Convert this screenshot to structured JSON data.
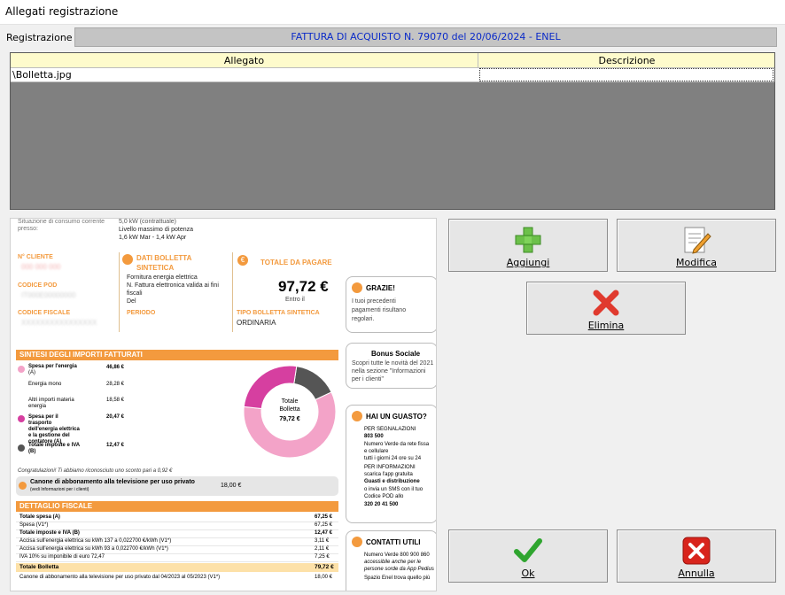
{
  "window": {
    "title": "Allegati registrazione"
  },
  "registration": {
    "label": "Registrazione",
    "value": "FATTURA DI ACQUISTO N. 79070 del 20/06/2024 - ENEL"
  },
  "grid": {
    "columns": [
      "Allegato",
      "Descrizione"
    ],
    "rows": [
      {
        "file": "\\Bolletta.jpg",
        "description": ""
      }
    ]
  },
  "buttons": {
    "add": "Aggiungi",
    "edit": "Modifica",
    "delete": "Elimina",
    "ok": "Ok",
    "cancel": "Annulla"
  },
  "icons": {
    "add": "plus-icon",
    "edit": "edit-document-icon",
    "delete": "red-x-icon",
    "ok": "green-check-icon",
    "cancel": "red-x-square-icon"
  },
  "preview": {
    "top_left_1": "Situazione di consumo corrente",
    "top_left_2": "presso:",
    "top_mid_1": "5,0 kW (contrattuale)",
    "top_mid_2": "Livello massimo di potenza",
    "top_mid_3": "1,6 kW Mar - 1,4 kW Apr",
    "cliente_label": "N° CLIENTE",
    "cliente_value": "000 000 000",
    "pod_label": "CODICE POD",
    "pod_value": "IT000E00000000",
    "cf_label": "CODICE FISCALE",
    "cf_value": "XXXXXXXXXXXXXXXX",
    "dati_title_1": "DATI BOLLETTA",
    "dati_title_2": "SINTETICA",
    "dati_line_1": "Fornitura energia elettrica",
    "dati_line_2": "N. Fattura elettronica valida ai fini",
    "dati_line_3": "fiscali",
    "dati_line_4": "Del",
    "periodo_label": "PERIODO",
    "totale_title": "TOTALE DA PAGARE",
    "totale_value": "97,72 €",
    "entro": "Entro il",
    "tipo_label": "TIPO BOLLETTA SINTETICA",
    "tipo_value": "ORDINARIA",
    "grazie_title": "GRAZIE!",
    "grazie_text_1": "I tuoi precedenti",
    "grazie_text_2": "pagamenti risultano",
    "grazie_text_3": "regolari.",
    "bonus_title": "Bonus Sociale",
    "bonus_text_1": "Scopri tutte le novità del 2021",
    "bonus_text_2": "nella sezione \"Informazioni",
    "bonus_text_3": "per i clienti\"",
    "sintesi_title": "SINTESI DEGLI IMPORTI FATTURATI",
    "s_energia": "Spesa per l'energia",
    "s_energia_val": "46,86 €",
    "s_a": "(A)",
    "s_energia_mono": "Energia mono",
    "s_energia_mono_val": "28,28 €",
    "s_altri": "Altri importi materia",
    "s_altri_2": "energia",
    "s_altri_val": "18,58 €",
    "s_trasporto_1": "Spesa per il",
    "s_trasporto_2": "trasporto",
    "s_trasporto_3": "dell'energia elettrica",
    "s_trasporto_4": "e la gestione del",
    "s_trasporto_5": "contatore (A)",
    "s_trasporto_val": "20,47 €",
    "s_imposte_1": "Totale imposte e IVA",
    "s_imposte_2": "(B)",
    "s_imposte_val": "12,47 €",
    "donut_label_1": "Totale",
    "donut_label_2": "Bolletta",
    "donut_value": "79,72 €",
    "congrat": "Congratulazioni! Ti abbiamo riconosciuto uno sconto pari a 0,92 €",
    "canone_1": "Canone di abbonamento alla televisione per uso privato",
    "canone_2": "(vedi Informazioni per i clienti)",
    "canone_val": "18,00 €",
    "guasto_title": "HAI UN GUASTO?",
    "guasto_1": "PER SEGNALAZIONI",
    "guasto_2": "803 500",
    "guasto_3": "Numero Verde da rete fissa",
    "guasto_4": "e cellulare",
    "guasto_5": "tutti i giorni 24 ore su 24",
    "guasto_6": "PER INFORMAZIONI",
    "guasto_7": "scarica l'app gratuita",
    "guasto_8": "Guasti e distribuzione",
    "guasto_9": "o invia un SMS con il tuo",
    "guasto_10": "Codice POD allo",
    "guasto_11": "320 20 41 500",
    "dettaglio_title": "DETTAGLIO FISCALE",
    "d_rows": [
      {
        "label": "Totale spesa (A)",
        "value": "67,25 €",
        "bold": true
      },
      {
        "label": "Spesa (V1*)",
        "value": "67,25 €",
        "bold": false
      },
      {
        "label": "Totale imposte e IVA (B)",
        "value": "12,47 €",
        "bold": true
      },
      {
        "label": "Accisa sull'energia elettrica su kWh 137 a 0,022700 €/kWh (V1*)",
        "value": "3,11 €",
        "bold": false
      },
      {
        "label": "Accisa sull'energia elettrica su kWh 93 a 0,022700 €/kWh (V1*)",
        "value": "2,11 €",
        "bold": false
      },
      {
        "label": "IVA 10% su imponibile di euro 72,47",
        "value": "7,25 €",
        "bold": false
      }
    ],
    "d_total_label": "Totale Bolletta",
    "d_total_value": "79,72 €",
    "d_canone": "Canone di abbonamento alla televisione per uso privato dal 04/2023 al 05/2023 (V1*)",
    "d_canone_val": "18,00 €",
    "contatti_title": "CONTATTI UTILI",
    "contatti_1": "Numero Verde 800 900 860",
    "contatti_2": "accessibile anche per le",
    "contatti_3": "persone sorde da App Pedius",
    "contatti_4": "Spazio Enel trova quello più"
  },
  "chart_data": {
    "type": "pie",
    "categories": [
      "Spesa per l'energia",
      "Spesa per il trasporto dell'energia elettrica e la gestione del contatore (A)",
      "Totale imposte e IVA (B)"
    ],
    "values": [
      46.86,
      20.47,
      12.47
    ],
    "colors": [
      "#f3a3c8",
      "#d63fa0",
      "#555555"
    ],
    "title": "Totale Bolletta 79,72 €"
  }
}
